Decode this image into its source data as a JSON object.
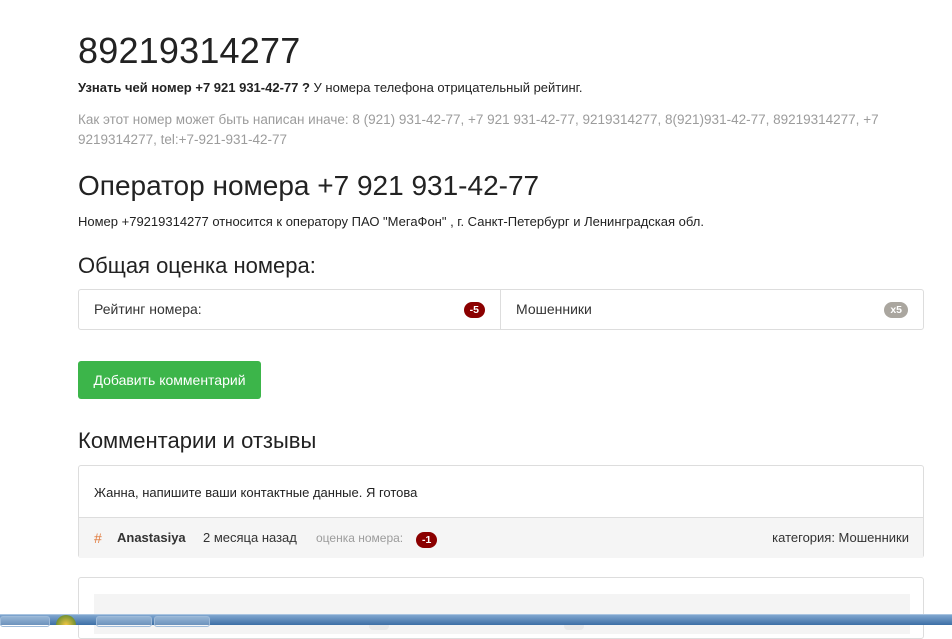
{
  "page": {
    "title": "89219314277",
    "intro_bold": "Узнать чей номер +7 921 931-42-77 ?",
    "intro_rest": " У номера телефона отрицательный рейтинг.",
    "alt_formats": "Как этот номер может быть написан иначе: 8 (921) 931-42-77, +7 921 931-42-77, 9219314277, 8(921)931-42-77, 89219314277, +7 9219314277, tel:+7-921-931-42-77"
  },
  "operator": {
    "heading": "Оператор номера +7 921 931-42-77",
    "text": "Номер +79219314277 относится к оператору ПАО \"МегаФон\" , г. Санкт-Петербург и Ленинградская обл."
  },
  "rating": {
    "heading": "Общая оценка номера:",
    "label": "Рейтинг номера:",
    "value": "-5",
    "category": "Мошенники",
    "category_count": "x5"
  },
  "actions": {
    "add_comment": "Добавить комментарий"
  },
  "comments": {
    "heading": "Комментарии и отзывы",
    "items": [
      {
        "text": "Жанна, напишите ваши контактные данные. Я готова",
        "hash": "#",
        "author": "Anastasiya",
        "time": "2 месяца назад",
        "score_label": "оценка номера:",
        "score": "-1",
        "category": "категория: Мошенники"
      }
    ]
  },
  "colors": {
    "accent_green": "#3cb54a",
    "negative_badge": "#8b0000",
    "neutral_badge": "#aaa69f",
    "hash_orange": "#e07a3c"
  }
}
